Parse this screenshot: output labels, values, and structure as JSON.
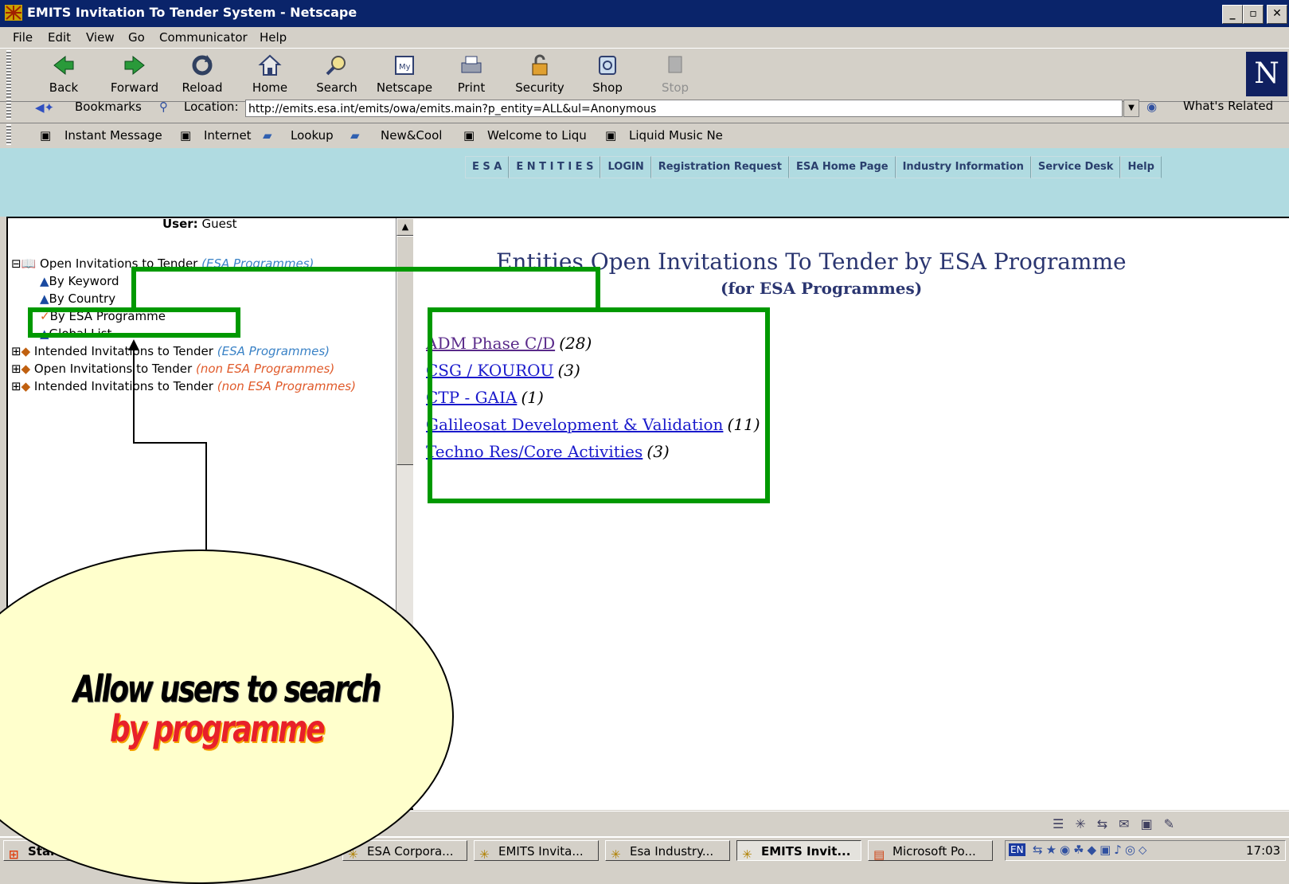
{
  "window": {
    "title": "EMITS Invitation To Tender System - Netscape"
  },
  "menu": [
    "File",
    "Edit",
    "View",
    "Go",
    "Communicator",
    "Help"
  ],
  "toolbar": [
    {
      "label": "Back",
      "icon": "back-icon"
    },
    {
      "label": "Forward",
      "icon": "forward-icon"
    },
    {
      "label": "Reload",
      "icon": "reload-icon"
    },
    {
      "label": "Home",
      "icon": "home-icon"
    },
    {
      "label": "Search",
      "icon": "search-icon"
    },
    {
      "label": "Netscape",
      "icon": "netscape-icon"
    },
    {
      "label": "Print",
      "icon": "print-icon"
    },
    {
      "label": "Security",
      "icon": "security-icon"
    },
    {
      "label": "Shop",
      "icon": "shop-icon"
    },
    {
      "label": "Stop",
      "icon": "stop-icon"
    }
  ],
  "location": {
    "bookmarks": "Bookmarks",
    "label": "Location:",
    "url": "http://emits.esa.int/emits/owa/emits.main?p_entity=ALL&ul=Anonymous",
    "related": "What's Related"
  },
  "personal": [
    "Instant Message",
    "Internet",
    "Lookup",
    "New&Cool",
    "Welcome to Liqu",
    "Liquid Music Ne"
  ],
  "nav": [
    "E S A",
    "E N T I T I E S",
    "LOGIN",
    "Registration Request",
    "ESA Home Page",
    "Industry Information",
    "Service Desk",
    "Help"
  ],
  "sidebar": {
    "user_label": "User:",
    "user_value": "Guest",
    "tree": {
      "open_label": "Open Invitations to Tender",
      "open_note": "(ESA Programmes)",
      "by_keyword": "By Keyword",
      "by_country": "By Country",
      "by_programme": "By ESA Programme",
      "global_list": "Global List",
      "intended_esa": "Intended Invitations to Tender",
      "intended_esa_note": "(ESA Programmes)",
      "open_non": "Open Invitations to Tender",
      "open_non_note": "(non ESA Programmes)",
      "intended_non": "Intended Invitations to Tender",
      "intended_non_note": "(non ESA Programmes)"
    }
  },
  "main": {
    "title": "Entities Open Invitations To Tender by ESA Programme",
    "subtitle": "(for ESA Programmes)",
    "programmes": [
      {
        "name": "ADM Phase C/D",
        "count": "(28)"
      },
      {
        "name": "CSG / KOUROU",
        "count": "(3)"
      },
      {
        "name": "CTP - GAIA",
        "count": "(1)"
      },
      {
        "name": "Galileosat Development & Validation",
        "count": "(11)"
      },
      {
        "name": "Techno Res/Core Activities",
        "count": "(3)"
      }
    ]
  },
  "callout": {
    "line1": "Allow users to search",
    "line2": "by programme"
  },
  "taskbar": {
    "start": "Start",
    "tasks": [
      "ESA Corpora...",
      "EMITS Invita...",
      "Esa Industry...",
      "EMITS Invit...",
      "Microsoft Po..."
    ],
    "lang": "EN",
    "clock": "17:03"
  },
  "colors": {
    "highlight": "#009900",
    "banner": "#b0dbe1",
    "titlebar": "#0a246a"
  }
}
